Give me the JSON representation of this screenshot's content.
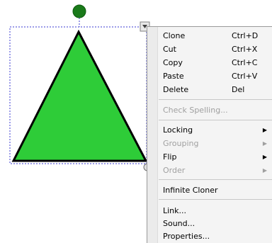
{
  "shape": {
    "fill_color": "#2ecc38",
    "stroke_color": "#000000",
    "rotate_handle_color": "#1a7a1a",
    "selection_color": "#3a3ad0"
  },
  "menu": {
    "items": [
      {
        "label": "Clone",
        "shortcut": "Ctrl+D"
      },
      {
        "label": "Cut",
        "shortcut": "Ctrl+X"
      },
      {
        "label": "Copy",
        "shortcut": "Ctrl+C"
      },
      {
        "label": "Paste",
        "shortcut": "Ctrl+V"
      },
      {
        "label": "Delete",
        "shortcut": "Del"
      },
      {
        "label": "Check Spelling...",
        "disabled": true
      },
      {
        "label": "Locking"
      },
      {
        "label": "Grouping",
        "disabled": true
      },
      {
        "label": "Flip"
      },
      {
        "label": "Order",
        "disabled": true
      },
      {
        "label": "Infinite Cloner"
      },
      {
        "label": "Link..."
      },
      {
        "label": "Sound..."
      },
      {
        "label": "Properties..."
      }
    ],
    "submenu_arrow": "▶"
  }
}
